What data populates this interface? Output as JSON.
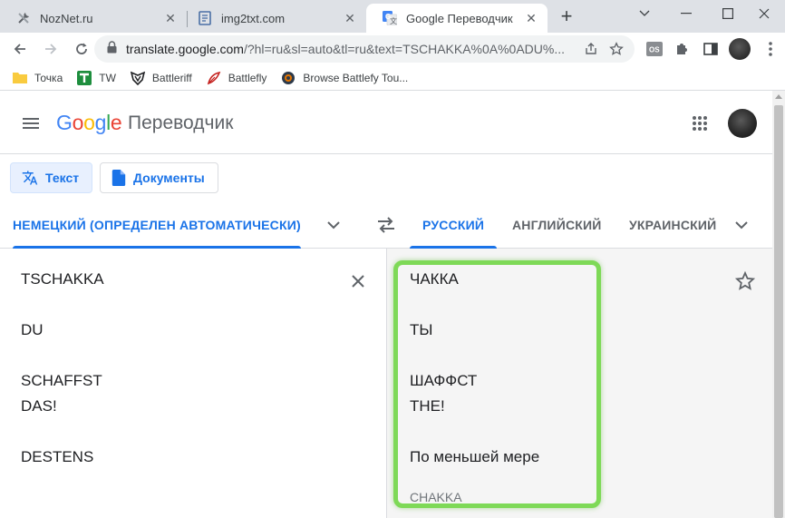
{
  "browser": {
    "tabs": [
      {
        "title": "NozNet.ru",
        "icon": "tools-icon",
        "active": false
      },
      {
        "title": "img2txt.com",
        "icon": "document-icon",
        "active": false
      },
      {
        "title": "Google Переводчик",
        "icon": "google-translate-icon",
        "active": true
      }
    ],
    "url_main": "translate.google.com",
    "url_rest": "/?hl=ru&sl=auto&tl=ru&text=TSCHAKKA%0A%0ADU%...",
    "bookmarks": [
      {
        "label": "Точка",
        "icon": "folder-icon"
      },
      {
        "label": "TW",
        "icon": "tw-icon"
      },
      {
        "label": "Battleriff",
        "icon": "battleriff-icon"
      },
      {
        "label": "Battlefly",
        "icon": "battlefly-icon"
      },
      {
        "label": "Browse Battlefy Tou...",
        "icon": "battlefy-icon"
      }
    ]
  },
  "app": {
    "logo_letters": [
      "G",
      "o",
      "o",
      "g",
      "l",
      "e"
    ],
    "logo_colors": [
      "#4285f4",
      "#ea4335",
      "#fbbc05",
      "#4285f4",
      "#34a853",
      "#ea4335"
    ],
    "product_name": "Переводчик",
    "modes": {
      "text": "Текст",
      "documents": "Документы"
    },
    "source_lang": "НЕМЕЦКИЙ (ОПРЕДЕЛЕН АВТОМАТИЧЕСКИ)",
    "target_langs": [
      "РУССКИЙ",
      "АНГЛИЙСКИЙ",
      "УКРАИНСКИЙ"
    ],
    "source_text": "TSCHAKKA\n\nDU\n\nSCHAFFST\nDAS!\n\nDESTENS",
    "translation_text": "ЧАККА\n\nТЫ\n\nШАФФСТ\nTHE!\n\nПо меньшей мере",
    "alt_label": "CHAKKA",
    "accent": "#1a73e8",
    "highlight_color": "#7ed957"
  }
}
